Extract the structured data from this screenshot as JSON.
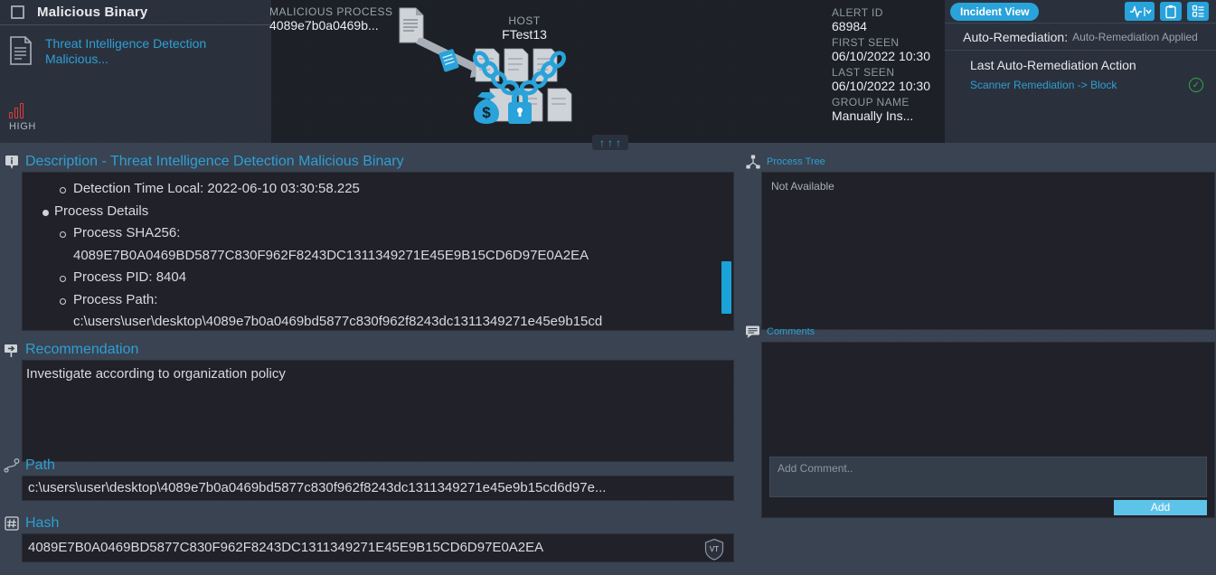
{
  "header": {
    "checkbox_checked": false,
    "title": "Malicious Binary",
    "alert_name": "Threat Intelligence Detection Malicious...",
    "severity": {
      "label": "HIGH",
      "color": "#e03b3b",
      "level": 3
    },
    "diagram": {
      "process_caption": "MALICIOUS PROCESS",
      "process_value": "4089e7b0a0469b...",
      "host_caption": "HOST",
      "host_value": "FTest13"
    },
    "meta": [
      {
        "key": "ALERT ID",
        "value": "68984"
      },
      {
        "key": "FIRST SEEN",
        "value": "06/10/2022 10:30"
      },
      {
        "key": "LAST SEEN",
        "value": "06/10/2022 10:30"
      },
      {
        "key": "GROUP NAME",
        "value": "Manually Ins..."
      }
    ],
    "incident_view_button": "Incident View",
    "icon_buttons": [
      "activity-chart-icon",
      "clipboard-icon",
      "details-list-icon"
    ],
    "auto_remediation_label": "Auto-Remediation:",
    "auto_remediation_status": "Auto-Remediation Applied",
    "last_action_title": "Last Auto-Remediation Action",
    "last_action_value": "Scanner Remediation -> Block",
    "last_action_ok": "✓",
    "collapse_arrows": [
      "↑",
      "↑",
      "↑"
    ]
  },
  "description": {
    "title": "Description - Threat Intelligence Detection Malicious Binary",
    "items": [
      {
        "level": 2,
        "text": "Detection Time Local: 2022-06-10 03:30:58.225"
      },
      {
        "level": 1,
        "text": "Process Details"
      },
      {
        "level": 2,
        "text": "Process SHA256:"
      },
      {
        "level": 0,
        "text": "4089E7B0A0469BD5877C830F962F8243DC1311349271E45E9B15CD6D97E0A2EA"
      },
      {
        "level": 2,
        "text": "Process PID: 8404"
      },
      {
        "level": 2,
        "text": "Process Path:"
      },
      {
        "level": 0,
        "text": "c:\\users\\user\\desktop\\4089e7b0a0469bd5877c830f962f8243dc1311349271e45e9b15cd"
      }
    ]
  },
  "recommendation": {
    "title": "Recommendation",
    "text": "Investigate according to organization policy"
  },
  "path": {
    "title": "Path",
    "value": "c:\\users\\user\\desktop\\4089e7b0a0469bd5877c830f962f8243dc1311349271e45e9b15cd6d97e..."
  },
  "hash": {
    "title": "Hash",
    "value": "4089E7B0A0469BD5877C830F962F8243DC1311349271E45E9B15CD6D97E0A2EA",
    "vt_label": "VT"
  },
  "process_tree": {
    "title": "Process Tree",
    "status": "Not Available"
  },
  "comments": {
    "title": "Comments",
    "input_placeholder": "Add Comment..",
    "input_value": "",
    "add_button": "Add"
  },
  "colors": {
    "accent": "#29a3d9",
    "link": "#2e9fd4",
    "severity_high": "#e03b3b",
    "success": "#2faa4a",
    "panel_bg": "#212229",
    "page_bg": "#394351"
  }
}
